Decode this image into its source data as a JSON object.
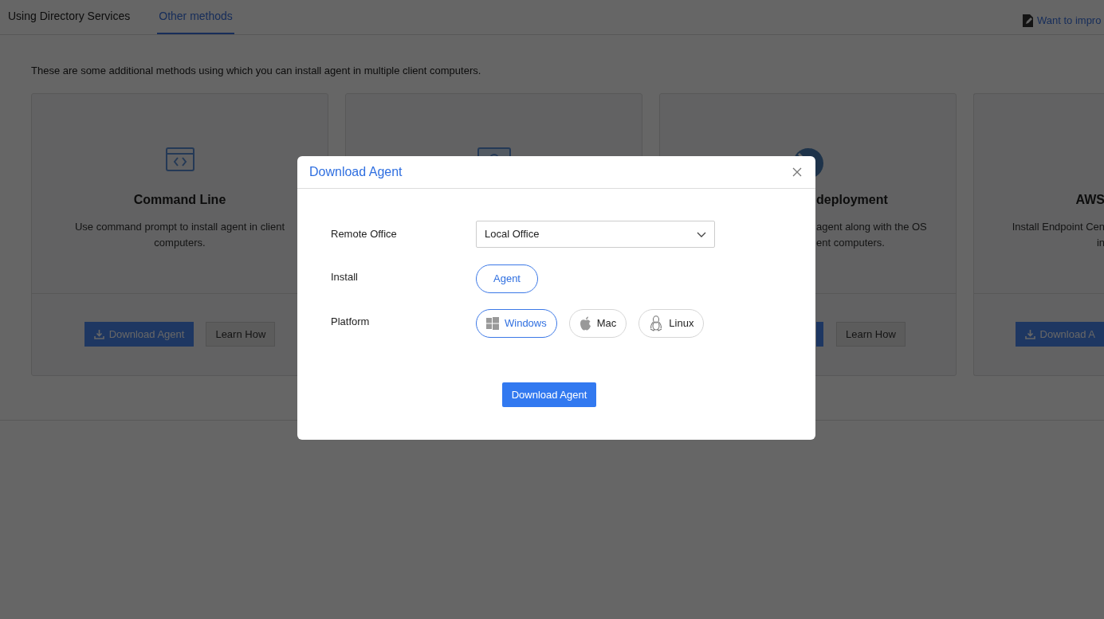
{
  "tabs": [
    {
      "label": "Using Directory Services",
      "selected": false
    },
    {
      "label": "Other methods",
      "selected": true
    }
  ],
  "feedback_link": "Want to impro",
  "intro": "These are some additional methods using which you can install agent in multiple client computers.",
  "cards": [
    {
      "kind": "full",
      "title": "Command Line",
      "description": [
        "Use command prompt to install agent in client computers."
      ],
      "buttons": [
        {
          "kind": "download",
          "label": "Download Agent"
        },
        {
          "kind": "learn",
          "label": "Learn How"
        }
      ]
    },
    {
      "kind": "covered"
    },
    {
      "kind": "cut_left",
      "title": "deployment",
      "description": [
        "agent along with the OS",
        "ent computers."
      ],
      "buttons": [
        {
          "kind": "download"
        },
        {
          "kind": "learn",
          "label": "Learn How"
        }
      ]
    },
    {
      "kind": "cut_right",
      "title": "AWS",
      "description": [
        "Install Endpoint Cen",
        "in"
      ],
      "buttons": [
        {
          "kind": "download",
          "label": "Download A"
        }
      ]
    }
  ],
  "dialog": {
    "title": "Download Agent",
    "remote_office": {
      "label": "Remote Office",
      "value": "Local Office"
    },
    "install": {
      "label": "Install",
      "options": [
        {
          "label": "Agent",
          "selected": true
        }
      ]
    },
    "platform": {
      "label": "Platform",
      "options": [
        {
          "kind": "windows",
          "label": "Windows",
          "selected": true
        },
        {
          "kind": "apple",
          "label": "Mac",
          "selected": false
        },
        {
          "kind": "linux",
          "label": "Linux",
          "selected": false
        }
      ]
    },
    "submit": "Download Agent"
  }
}
